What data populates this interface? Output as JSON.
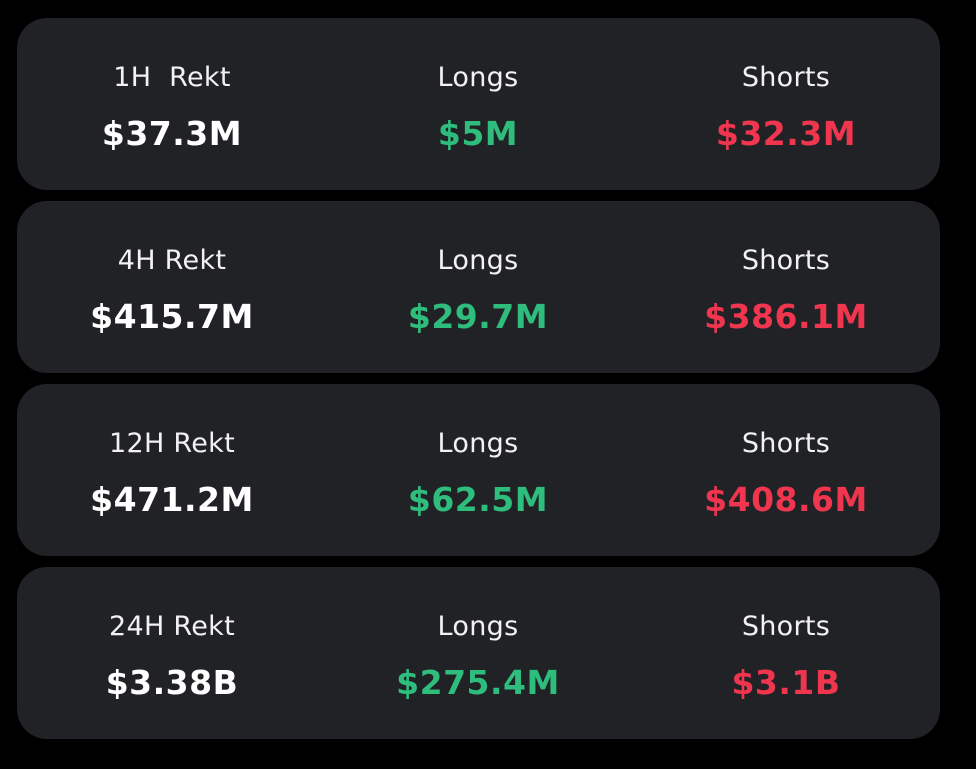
{
  "colors": {
    "background": "#000000",
    "panel": "#212226",
    "total": "#ffffff",
    "longs": "#2ebd7c",
    "shorts": "#f0364f"
  },
  "stats": [
    {
      "period_label": "1H  Rekt",
      "total": "$37.3M",
      "longs_label": "Longs",
      "longs": "$5M",
      "shorts_label": "Shorts",
      "shorts": "$32.3M"
    },
    {
      "period_label": "4H Rekt",
      "total": "$415.7M",
      "longs_label": "Longs",
      "longs": "$29.7M",
      "shorts_label": "Shorts",
      "shorts": "$386.1M"
    },
    {
      "period_label": "12H Rekt",
      "total": "$471.2M",
      "longs_label": "Longs",
      "longs": "$62.5M",
      "shorts_label": "Shorts",
      "shorts": "$408.6M"
    },
    {
      "period_label": "24H Rekt",
      "total": "$3.38B",
      "longs_label": "Longs",
      "longs": "$275.4M",
      "shorts_label": "Shorts",
      "shorts": "$3.1B"
    }
  ]
}
